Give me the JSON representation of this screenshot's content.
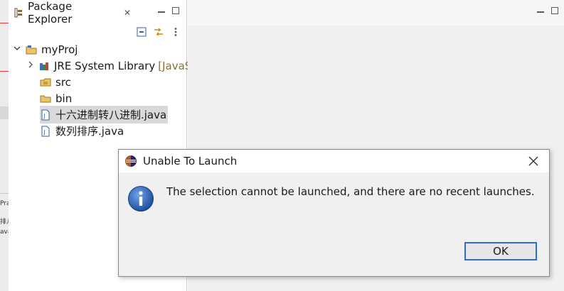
{
  "explorer": {
    "title": "Package Explorer",
    "close_glyph": "✕",
    "tree": {
      "project": "myProj",
      "jre_label": "JRE System Library",
      "jre_decor": "[JavaS",
      "src": "src",
      "bin": "bin",
      "file1": "十六进制转八进制.java",
      "file2": "数列排序.java"
    }
  },
  "left_fragments": [
    "Pra",
    "排八",
    "ava"
  ],
  "dialog": {
    "title": "Unable To Launch",
    "message": "The selection cannot be launched, and there are no recent launches.",
    "ok_label": "OK"
  },
  "colors": {
    "accent": "#2f6fd1",
    "info_icon": "#2a5fb4"
  }
}
